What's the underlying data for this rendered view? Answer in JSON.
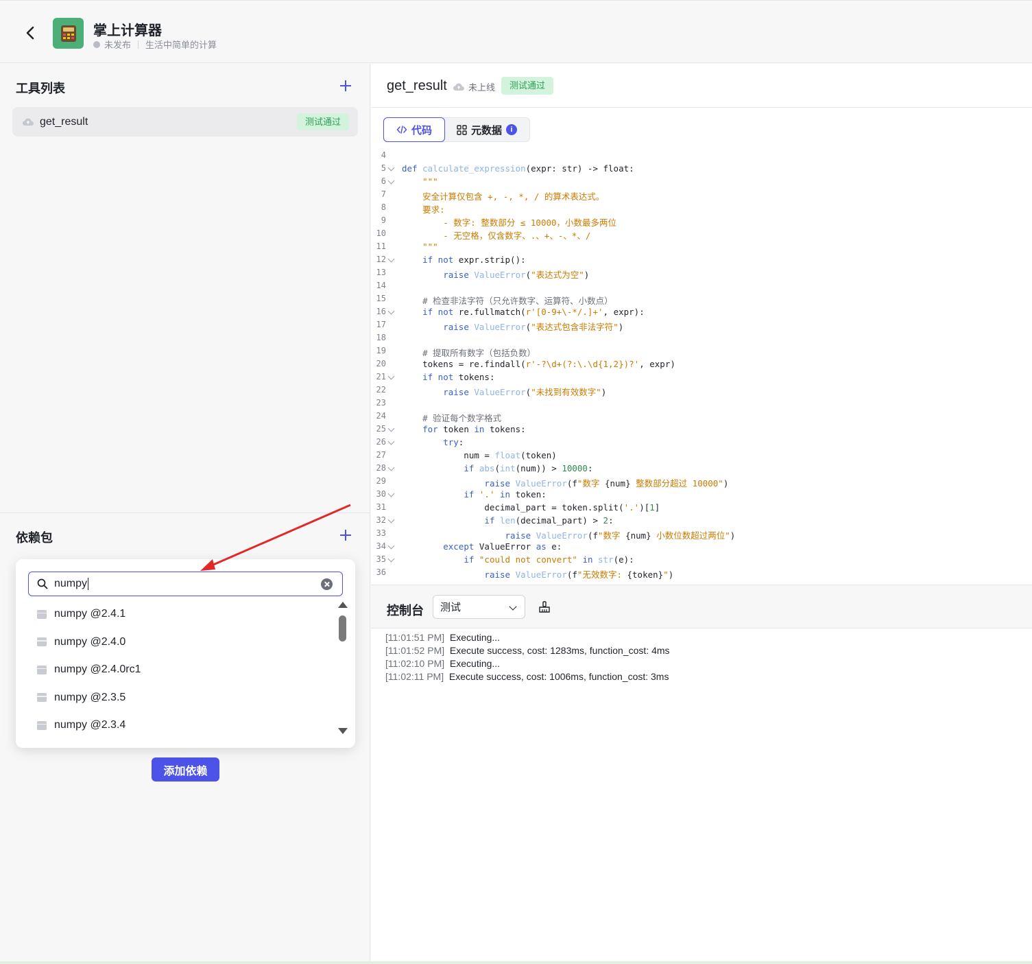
{
  "header": {
    "title": "掌上计算器",
    "status": "未发布",
    "description": "生活中简单的计算"
  },
  "tool_list": {
    "title": "工具列表",
    "items": [
      {
        "name": "get_result",
        "badge": "测试通过"
      }
    ]
  },
  "dependencies": {
    "title": "依赖包",
    "search_value": "numpy",
    "results": [
      "numpy @2.4.1",
      "numpy @2.4.0",
      "numpy @2.4.0rc1",
      "numpy @2.3.5",
      "numpy @2.3.4"
    ],
    "add_button": "添加依赖"
  },
  "tool_detail": {
    "name": "get_result",
    "online_status": "未上线",
    "badge": "测试通过",
    "tabs": [
      {
        "label": "代码",
        "icon": "code-icon",
        "active": true
      },
      {
        "label": "元数据",
        "icon": "grid-icon",
        "active": false,
        "info": "i"
      }
    ]
  },
  "code_lines": [
    {
      "n": "4",
      "fold": false,
      "html": ""
    },
    {
      "n": "5",
      "fold": true,
      "html": "<span class=\"kw\">def</span> <span class=\"fn\">calculate_expression</span>(expr: str) -&gt; float:"
    },
    {
      "n": "6",
      "fold": true,
      "html": "    <span class=\"str\">\"\"\"</span>"
    },
    {
      "n": "7",
      "fold": false,
      "html": "    <span class=\"str\">安全计算仅包含 +, -, *, / 的算术表达式。</span>"
    },
    {
      "n": "8",
      "fold": false,
      "html": "    <span class=\"str\">要求:</span>"
    },
    {
      "n": "9",
      "fold": false,
      "html": "        <span class=\"str\">- 数字: 整数部分 ≤ 10000，小数最多两位</span>"
    },
    {
      "n": "10",
      "fold": false,
      "html": "        <span class=\"str\">- 无空格，仅含数字、.、+、-、*、/</span>"
    },
    {
      "n": "11",
      "fold": false,
      "html": "    <span class=\"str\">\"\"\"</span>"
    },
    {
      "n": "12",
      "fold": true,
      "html": "    <span class=\"kw\">if not</span> expr.strip():"
    },
    {
      "n": "13",
      "fold": false,
      "html": "        <span class=\"kw\">raise</span> <span class=\"fn\">ValueError</span>(<span class=\"str\">\"表达式为空\"</span>)"
    },
    {
      "n": "14",
      "fold": false,
      "html": ""
    },
    {
      "n": "15",
      "fold": false,
      "html": "    <span class=\"cm\"># 检查非法字符（只允许数字、运算符、小数点）</span>"
    },
    {
      "n": "16",
      "fold": true,
      "html": "    <span class=\"kw\">if not</span> re.fullmatch(<span class=\"str\">r'[0-9+\\-*/.]+'</span>, expr):"
    },
    {
      "n": "17",
      "fold": false,
      "html": "        <span class=\"kw\">raise</span> <span class=\"fn\">ValueError</span>(<span class=\"str\">\"表达式包含非法字符\"</span>)"
    },
    {
      "n": "18",
      "fold": false,
      "html": ""
    },
    {
      "n": "19",
      "fold": false,
      "html": "    <span class=\"cm\"># 提取所有数字（包括负数）</span>"
    },
    {
      "n": "20",
      "fold": false,
      "html": "    tokens = re.findall(<span class=\"str\">r'-?\\d+(?:\\.\\d{1,2})?'</span>, expr)"
    },
    {
      "n": "21",
      "fold": true,
      "html": "    <span class=\"kw\">if not</span> tokens:"
    },
    {
      "n": "22",
      "fold": false,
      "html": "        <span class=\"kw\">raise</span> <span class=\"fn\">ValueError</span>(<span class=\"str\">\"未找到有效数字\"</span>)"
    },
    {
      "n": "23",
      "fold": false,
      "html": ""
    },
    {
      "n": "24",
      "fold": false,
      "html": "    <span class=\"cm\"># 验证每个数字格式</span>"
    },
    {
      "n": "25",
      "fold": true,
      "html": "    <span class=\"kw\">for</span> token <span class=\"kw\">in</span> tokens:"
    },
    {
      "n": "26",
      "fold": true,
      "html": "        <span class=\"kw\">try</span>:"
    },
    {
      "n": "27",
      "fold": false,
      "html": "            num = <span class=\"fn\">float</span>(token)"
    },
    {
      "n": "28",
      "fold": true,
      "html": "            <span class=\"kw\">if</span> <span class=\"fn\">abs</span>(<span class=\"fn\">int</span>(num)) &gt; <span class=\"num\">10000</span>:"
    },
    {
      "n": "29",
      "fold": false,
      "html": "                <span class=\"kw\">raise</span> <span class=\"fn\">ValueError</span>(f<span class=\"str\">\"数字 </span>{num}<span class=\"str\"> 整数部分超过 10000\"</span>)"
    },
    {
      "n": "30",
      "fold": true,
      "html": "            <span class=\"kw\">if</span> <span class=\"str\">'.'</span> <span class=\"kw\">in</span> token:"
    },
    {
      "n": "31",
      "fold": false,
      "html": "                decimal_part = token.split(<span class=\"str\">'.'</span>)[<span class=\"num\">1</span>]"
    },
    {
      "n": "32",
      "fold": true,
      "html": "                <span class=\"kw\">if</span> <span class=\"fn\">len</span>(decimal_part) &gt; <span class=\"num\">2</span>:"
    },
    {
      "n": "33",
      "fold": false,
      "html": "                    <span class=\"kw\">raise</span> <span class=\"fn\">ValueError</span>(f<span class=\"str\">\"数字 </span>{num}<span class=\"str\"> 小数位数超过两位\"</span>)"
    },
    {
      "n": "34",
      "fold": true,
      "html": "        <span class=\"kw\">except</span> ValueError <span class=\"kw\">as</span> e:"
    },
    {
      "n": "35",
      "fold": true,
      "html": "            <span class=\"kw\">if</span> <span class=\"str\">\"could not convert\"</span> <span class=\"kw\">in</span> <span class=\"fn\">str</span>(e):"
    },
    {
      "n": "36",
      "fold": false,
      "html": "                <span class=\"kw\">raise</span> <span class=\"fn\">ValueError</span>(f<span class=\"str\">\"无效数字: </span>{token}<span class=\"str\">\"</span>)"
    }
  ],
  "console": {
    "title": "控制台",
    "select_value": "测试",
    "logs": [
      {
        "time": "[11:01:51 PM]",
        "msg": "Executing..."
      },
      {
        "time": "[11:01:52 PM]",
        "msg": "Execute success, cost: 1283ms, function_cost: 4ms"
      },
      {
        "time": "[11:02:10 PM]",
        "msg": "Executing..."
      },
      {
        "time": "[11:02:11 PM]",
        "msg": "Execute success, cost: 1006ms, function_cost: 3ms"
      }
    ]
  },
  "colors": {
    "accent": "#4d53e8",
    "success_bg": "#d4f3dd",
    "success_text": "#2d9e55",
    "annotation_arrow": "#e02a2a"
  }
}
